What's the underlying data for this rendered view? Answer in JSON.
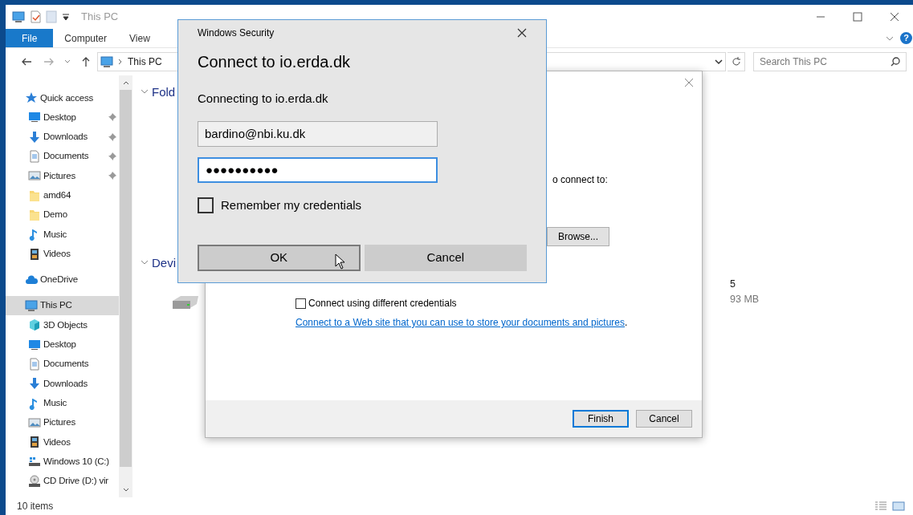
{
  "explorer": {
    "title": "This PC",
    "ribbon_tabs": [
      {
        "label": "File",
        "kind": "file",
        "selected": false
      },
      {
        "label": "Computer",
        "kind": "tab",
        "selected": false
      },
      {
        "label": "View",
        "kind": "tab",
        "selected": false
      }
    ],
    "help_glyph": "?",
    "address": {
      "path": "This PC"
    },
    "search": {
      "placeholder": "Search This PC"
    },
    "sidebar": {
      "items": [
        {
          "label": "Quick access",
          "kind": "star",
          "selected": false,
          "children": [
            {
              "label": "Desktop",
              "kind": "desktop",
              "pinned": true,
              "selected": false
            },
            {
              "label": "Downloads",
              "kind": "download",
              "pinned": true,
              "selected": false
            },
            {
              "label": "Documents",
              "kind": "document",
              "pinned": true,
              "selected": false
            },
            {
              "label": "Pictures",
              "kind": "picture",
              "pinned": true,
              "selected": false
            },
            {
              "label": "amd64",
              "kind": "folder",
              "pinned": false,
              "selected": false
            },
            {
              "label": "Demo",
              "kind": "folder",
              "pinned": false,
              "selected": false
            },
            {
              "label": "Music",
              "kind": "music",
              "pinned": false,
              "selected": false
            },
            {
              "label": "Videos",
              "kind": "video",
              "pinned": false,
              "selected": false
            }
          ]
        },
        {
          "label": "OneDrive",
          "kind": "cloud",
          "selected": false
        },
        {
          "label": "This PC",
          "kind": "pc",
          "selected": true,
          "children": [
            {
              "label": "3D Objects",
              "kind": "cube",
              "pinned": false,
              "selected": false
            },
            {
              "label": "Desktop",
              "kind": "desktop",
              "pinned": false,
              "selected": false
            },
            {
              "label": "Documents",
              "kind": "document",
              "pinned": false,
              "selected": false
            },
            {
              "label": "Downloads",
              "kind": "download",
              "pinned": false,
              "selected": false
            },
            {
              "label": "Music",
              "kind": "music",
              "pinned": false,
              "selected": false
            },
            {
              "label": "Pictures",
              "kind": "picture",
              "pinned": false,
              "selected": false
            },
            {
              "label": "Videos",
              "kind": "video",
              "pinned": false,
              "selected": false
            },
            {
              "label": "Windows 10 (C:)",
              "kind": "drive",
              "pinned": false,
              "selected": false
            },
            {
              "label": "CD Drive (D:) vir",
              "kind": "cd",
              "pinned": false,
              "selected": false
            }
          ]
        }
      ]
    },
    "sections": [
      "Fold",
      "Devi"
    ],
    "drive": {
      "name": "5",
      "size": "93 MB"
    },
    "status_bar": {
      "count": "10 items"
    }
  },
  "wizard": {
    "instruction": "o connect to:",
    "browse_button": "Browse...",
    "different_credentials": {
      "label": "Connect using different credentials",
      "checked": false
    },
    "link": "Connect to a Web site that you can use to store your documents and pictures",
    "link_suffix": ".",
    "buttons": [
      {
        "label": "Finish",
        "default": true
      },
      {
        "label": "Cancel",
        "default": false
      }
    ]
  },
  "security": {
    "title": "Windows Security",
    "heading": "Connect to io.erda.dk",
    "message": "Connecting to io.erda.dk",
    "fields": [
      {
        "value": "bardino@nbi.ku.dk",
        "focused": false
      },
      {
        "value": "●●●●●●●●●●",
        "focused": true
      }
    ],
    "remember": {
      "label": "Remember my credentials",
      "checked": false
    },
    "buttons": [
      {
        "label": "OK",
        "hovered": true
      },
      {
        "label": "Cancel",
        "hovered": false
      }
    ]
  }
}
